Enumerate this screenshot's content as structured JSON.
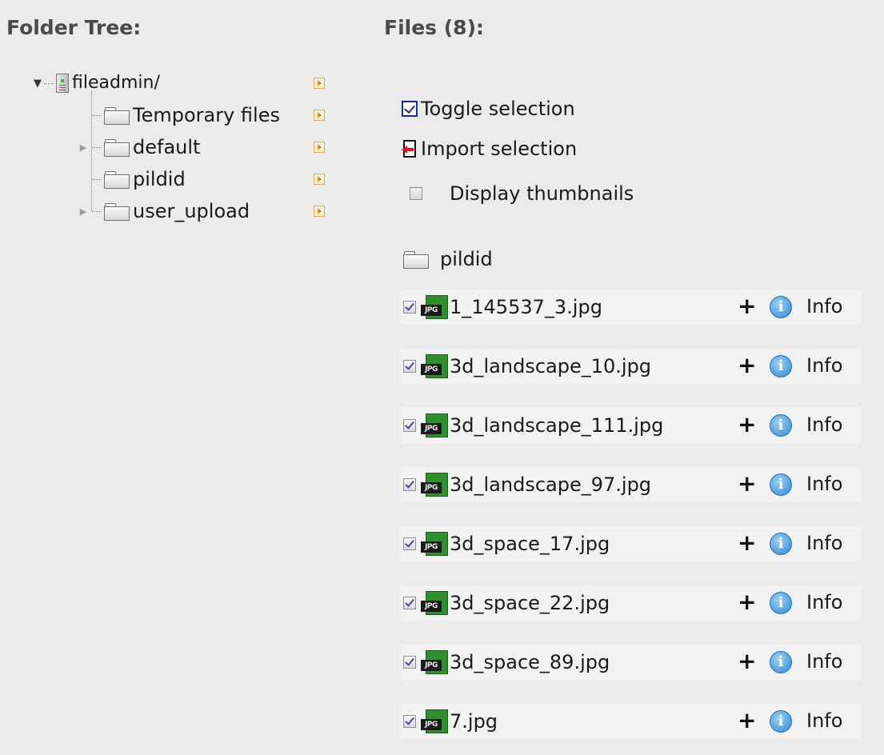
{
  "folder_tree": {
    "heading": "Folder Tree:",
    "root": {
      "label": "fileadmin/",
      "icon": "server-icon",
      "expanded": true
    },
    "children": [
      {
        "label": "Temporary files",
        "has_children": false
      },
      {
        "label": "default",
        "has_children": true
      },
      {
        "label": "pildid",
        "has_children": false
      },
      {
        "label": "user_upload",
        "has_children": true
      }
    ]
  },
  "files": {
    "heading": "Files (8):",
    "toggle_selection_label": "Toggle selection",
    "import_selection_label": "Import selection",
    "display_thumbnails_label": "Display thumbnails",
    "display_thumbnails_checked": false,
    "current_folder": "pildid",
    "type_badge": "JPG",
    "plus_label": "+",
    "info_glyph": "i",
    "info_label": "Info",
    "items": [
      {
        "name": "1_145537_3.jpg",
        "checked": true
      },
      {
        "name": "3d_landscape_10.jpg",
        "checked": true
      },
      {
        "name": "3d_landscape_111.jpg",
        "checked": true
      },
      {
        "name": "3d_landscape_97.jpg",
        "checked": true
      },
      {
        "name": "3d_space_17.jpg",
        "checked": true
      },
      {
        "name": "3d_space_22.jpg",
        "checked": true
      },
      {
        "name": "3d_space_89.jpg",
        "checked": true
      },
      {
        "name": "7.jpg",
        "checked": true
      }
    ]
  },
  "colors": {
    "background": "#ebebeb",
    "heading": "#4a4a4a",
    "jpg_icon": "#2f8f2f",
    "info_icon": "#2e89d6",
    "arrow_button": "#f08a00"
  }
}
